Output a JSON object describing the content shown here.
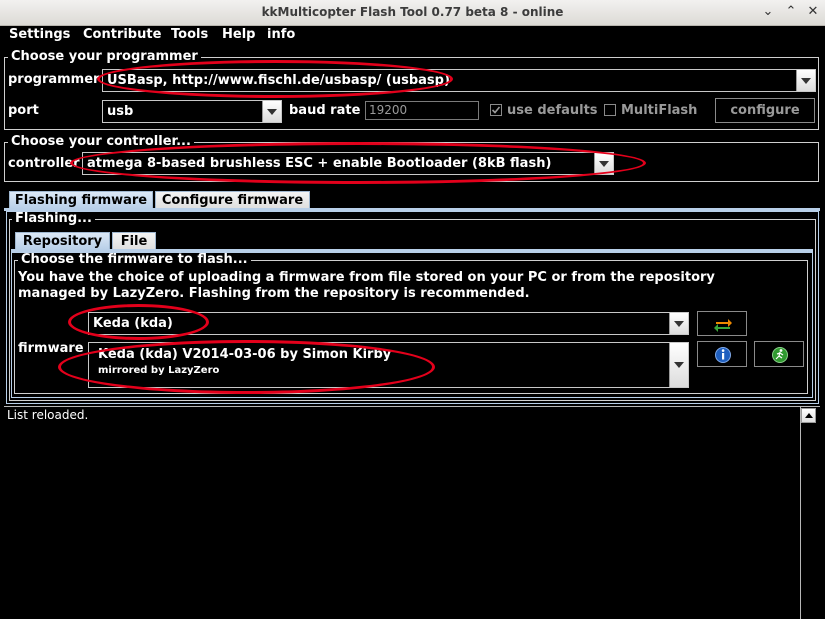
{
  "window": {
    "title": "kkMulticopter Flash Tool 0.77 beta 8 - online",
    "controls": {
      "minimize": "⌄",
      "maximize": "⌃",
      "close": "✕"
    }
  },
  "menu": {
    "items": [
      "Settings",
      "Contribute",
      "Tools",
      "Help",
      "info"
    ]
  },
  "programmer_group": {
    "title": "Choose your programmer",
    "programmer_label": "programmer",
    "programmer_value": "USBasp, http://www.fischl.de/usbasp/ (usbasp)",
    "port_label": "port",
    "port_value": "usb",
    "baud_label": "baud rate",
    "baud_value": "19200",
    "use_defaults_label": "use defaults",
    "use_defaults_checked": true,
    "multiflash_label": "MultiFlash",
    "multiflash_checked": false,
    "configure_label": "configure"
  },
  "controller_group": {
    "title": "Choose your controller...",
    "controller_label": "controller",
    "controller_value": "atmega 8-based brushless ESC + enable Bootloader (8kB flash)"
  },
  "main_tabs": [
    "Flashing firmware",
    "Configure firmware"
  ],
  "flashing_group": {
    "title": "Flashing...",
    "source_tabs": [
      "Repository",
      "File"
    ],
    "choose_title": "Choose the firmware to flash...",
    "description_line1": "You have the choice of uploading a firmware from file stored on your PC or from the repository",
    "description_line2": "managed by LazyZero. Flashing from the repository is recommended.",
    "firmware_label": "firmware",
    "firmware_value": "Keda (kda)",
    "firmware_detail_line1": "Keda (kda) V2014-03-06  by Simon Kirby",
    "firmware_detail_line2": "mirrored by LazyZero"
  },
  "log": {
    "text": "List reloaded."
  },
  "colors": {
    "annotation": "#e3001b",
    "tab_active": "#b8cfe8",
    "background": "#000000"
  }
}
